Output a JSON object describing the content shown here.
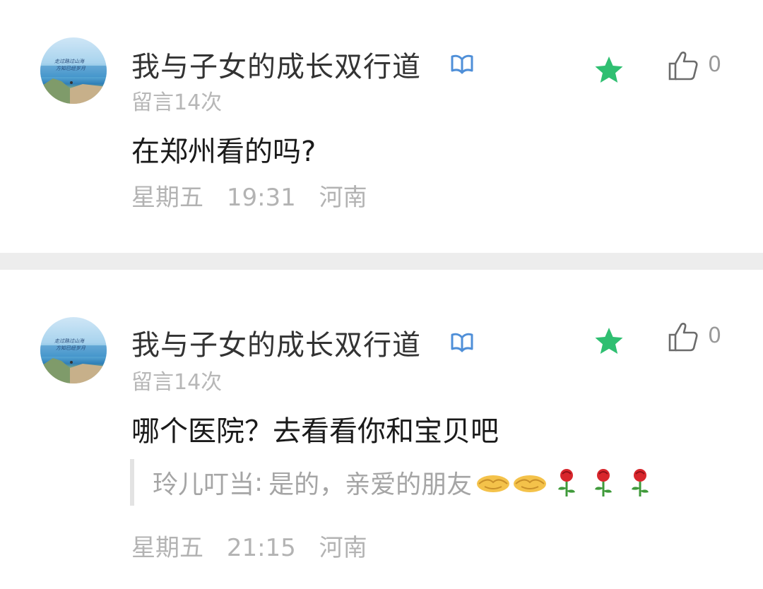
{
  "comments": [
    {
      "author": "我与子女的成长双行道",
      "message_count": "留言14次",
      "text": "在郑州看的吗?",
      "day": "星期五",
      "time": "19:31",
      "location": "河南",
      "likes": "0",
      "avatar_caption": "走过路过山海\n方知已经岁月"
    },
    {
      "author": "我与子女的成长双行道",
      "message_count": "留言14次",
      "text": "哪个医院？去看看你和宝贝吧",
      "day": "星期五",
      "time": "21:15",
      "location": "河南",
      "likes": "0",
      "avatar_caption": "走过路过山海\n方知已经岁月",
      "reply": {
        "author": "玲儿叮当",
        "separator": ":",
        "text": "是的，亲爱的朋友",
        "emojis": [
          "handshake-emoji",
          "handshake-emoji",
          "rose-emoji",
          "rose-emoji",
          "rose-emoji"
        ]
      }
    }
  ],
  "colors": {
    "star": "#2fbf71",
    "vip_badge": "#4f8fd8",
    "separator": "#ededed"
  }
}
